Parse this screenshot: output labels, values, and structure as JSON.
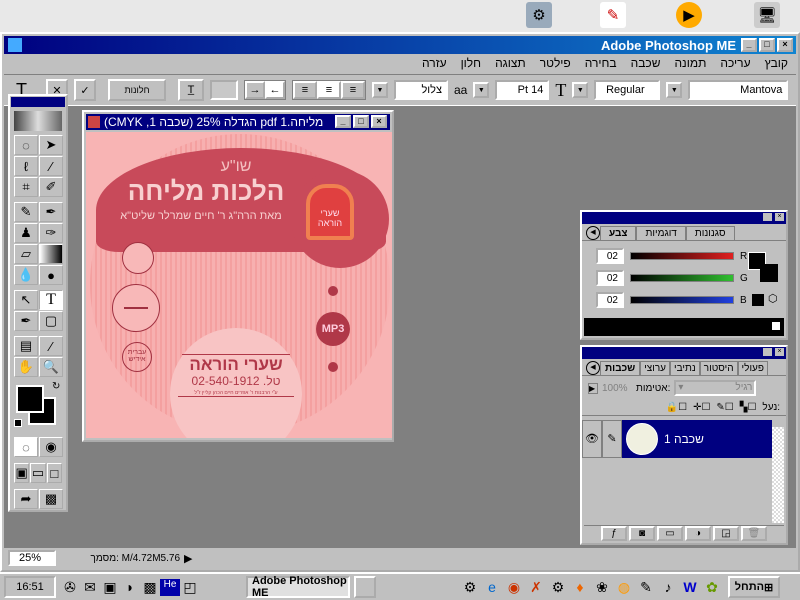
{
  "desktop": {
    "icons": [
      "network-icon",
      "pdf-icon",
      "media-player-icon",
      "computer-icon"
    ]
  },
  "app": {
    "title": "Adobe Photoshop ME"
  },
  "menu": [
    "קובץ",
    "עריכה",
    "תמונה",
    "שכבה",
    "בחירה",
    "פילטר",
    "תצוגה",
    "חלון",
    "עזרה"
  ],
  "options": {
    "palettes_button": "חלונות",
    "font_family": "Mantova",
    "font_style": "Regular",
    "font_size": "Pt 14",
    "antialias": "צלול"
  },
  "document": {
    "title": "מליחה.pdf 1 הגדלה 25% (שכבה 1, CMYK)",
    "cd": {
      "small_title": "שו\"ע",
      "main_title": "הלכות מליחה",
      "subtitle": "מאת הרה\"ג ר' חיים שמרלר שליט\"א",
      "logo_text": "שערי הוראה",
      "mp3": "MP3",
      "lang": "עברית אידיש",
      "publisher": "שערי הוראה",
      "phone": "טל. 02-540-1912",
      "address": "ע\"י הרבנות ר' אפרים חיים הכהן קליין ז\"ל"
    }
  },
  "color_palette": {
    "tabs": [
      "צבע",
      "דוגמיות",
      "סגנונות"
    ],
    "active_tab": "צבע",
    "channels": [
      {
        "label": "R",
        "value": "02",
        "color": "#e02020"
      },
      {
        "label": "G",
        "value": "02",
        "color": "#30c030"
      },
      {
        "label": "B",
        "value": "02",
        "color": "#2040e0"
      }
    ]
  },
  "layers_palette": {
    "tabs": [
      "שכבות",
      "ערוצי",
      "נתיבי",
      "היסטור",
      "פעולי"
    ],
    "active_tab": "שכבות",
    "blend_mode": "רגיל",
    "opacity_label": "אטימות:",
    "opacity": "100%",
    "lock_label": "נעל:",
    "layers": [
      {
        "name": "שכבה 1",
        "visible": true
      }
    ]
  },
  "status": {
    "zoom": "25%",
    "doc_info": "מסמך: M/4.72M5.76"
  },
  "taskbar": {
    "start": "התחל",
    "clock": "16:51",
    "task": "Adobe Photoshop ME"
  }
}
